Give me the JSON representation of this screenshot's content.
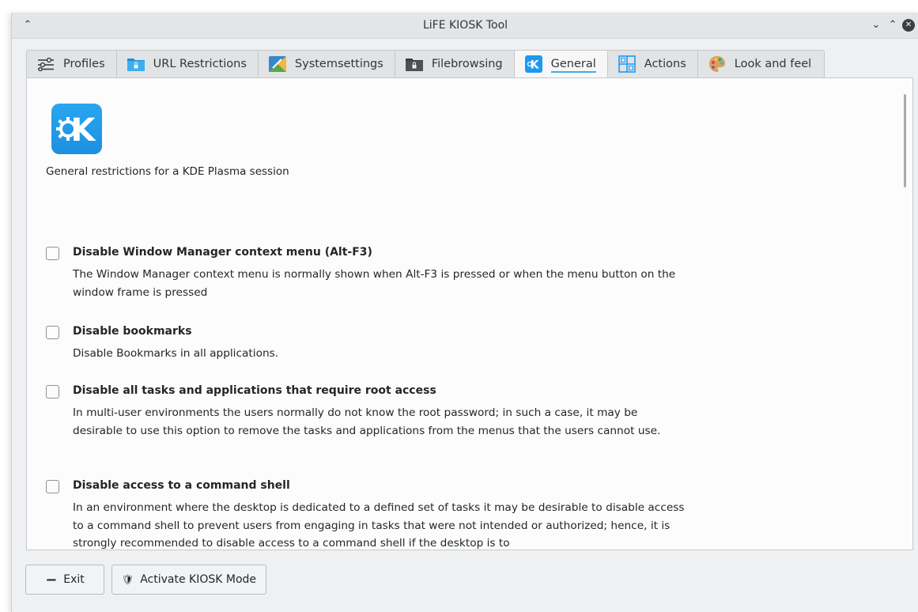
{
  "window": {
    "title": "LiFE KIOSK Tool"
  },
  "titlebar": {
    "keep_above_glyph": "⌃",
    "minimize_glyph": "⌄",
    "maximize_glyph": "⌃",
    "close_glyph": "✕"
  },
  "tabs": [
    {
      "label": "Profiles",
      "icon": "sliders-icon"
    },
    {
      "label": "URL Restrictions",
      "icon": "folder-lock-icon"
    },
    {
      "label": "Systemsettings",
      "icon": "system-settings-icon"
    },
    {
      "label": "Filebrowsing",
      "icon": "folder-lock-dark-icon"
    },
    {
      "label": "General",
      "icon": "kde-icon",
      "active": true
    },
    {
      "label": "Actions",
      "icon": "grid-icon"
    },
    {
      "label": "Look and feel",
      "icon": "palette-icon"
    }
  ],
  "general": {
    "logo_glyph": "K",
    "description": "General restrictions for a KDE Plasma session",
    "options": [
      {
        "title": "Disable Window Manager context menu (Alt-F3)",
        "description": "The Window Manager context menu is normally shown when Alt-F3 is pressed or when the menu button on the window frame is pressed",
        "checked": false
      },
      {
        "title": "Disable bookmarks",
        "description": "Disable Bookmarks in all applications.",
        "checked": false
      },
      {
        "title": "Disable all tasks and applications that require root access",
        "description": "In multi-user environments the users normally do not know the root password; in such a case, it may be desirable to use this option to remove the tasks and applications from the menus that the users cannot use.",
        "checked": false
      },
      {
        "title": "Disable access to a command shell",
        "description": "In an environment where the desktop is dedicated to a defined set of tasks it may be desirable to disable access to a command shell to prevent users from engaging in tasks that were not intended or authorized; hence, it is strongly recommended to disable access to a command shell if the desktop is to",
        "checked": false
      }
    ]
  },
  "footer": {
    "exit_glyph": "−",
    "exit_label": "Exit",
    "kiosk_glyph": "🛡",
    "kiosk_label": "Activate KIOSK Mode"
  },
  "colors": {
    "accent": "#3daee9",
    "kde_blue": "#1d99f3"
  }
}
